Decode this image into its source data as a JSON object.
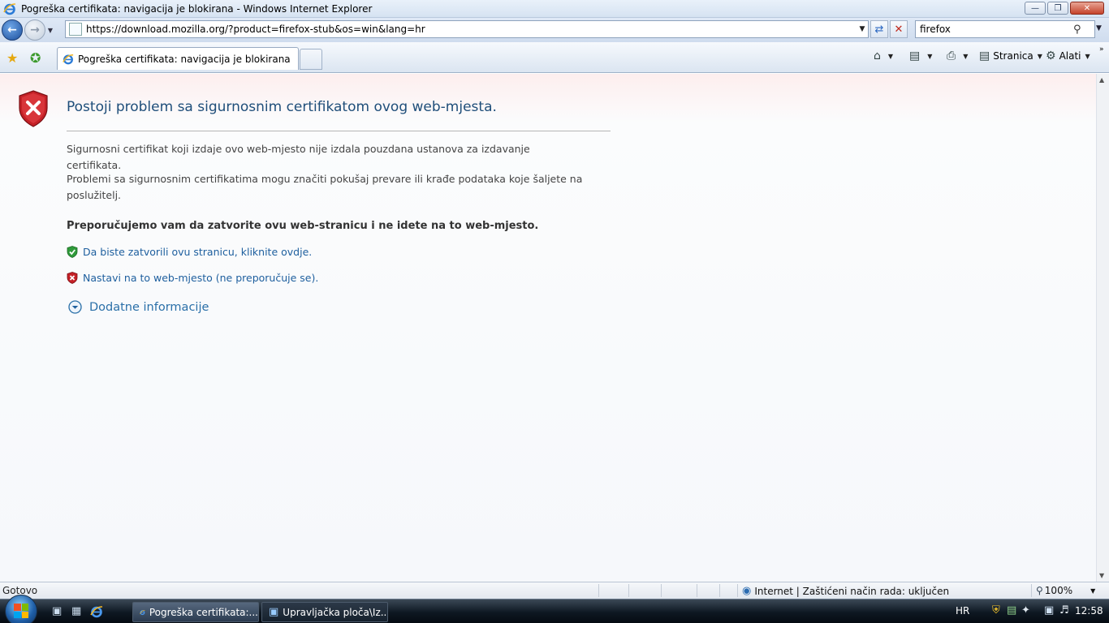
{
  "window": {
    "title": "Pogreška certifikata: navigacija je blokirana - Windows Internet Explorer",
    "buttons": {
      "minimize_icon": "minimize-icon",
      "restore_icon": "restore-icon",
      "close_icon": "close-icon"
    }
  },
  "addressbar": {
    "url": "https://download.mozilla.org/?product=firefox-stub&os=win&lang=hr",
    "search_value": "firefox"
  },
  "tabs": [
    {
      "label": "Pogreška certifikata: navigacija je blokirana"
    }
  ],
  "commandbar": {
    "page_label": "Stranica",
    "tools_label": "Alati"
  },
  "page": {
    "heading": "Postoji problem sa sigurnosnim certifikatom ovog web-mjesta.",
    "para1": "Sigurnosni certifikat koji izdaje ovo web-mjesto nije izdala pouzdana ustanova za izdavanje certifikata.",
    "para2": "Problemi sa sigurnosnim certifikatima mogu značiti pokušaj prevare ili krađe podataka koje šaljete na poslužitelj.",
    "recommendation": "Preporučujemo vam da zatvorite ovu web-stranicu i ne idete na to web-mjesto.",
    "link_close": "Da biste zatvorili ovu stranicu, kliknite ovdje.",
    "link_continue": "Nastavi na to web-mjesto (ne preporučuje se).",
    "more_info": "Dodatne informacije"
  },
  "statusbar": {
    "status": "Gotovo",
    "zone": "Internet | Zaštićeni način rada: uključen",
    "zoom": "100%"
  },
  "taskbar": {
    "tasks": [
      {
        "label": "Pogreška certifikata:..."
      },
      {
        "label": "Upravljačka ploča\\Iz..."
      }
    ],
    "language": "HR",
    "clock": "12:58"
  },
  "colors": {
    "heading": "#1f4e7a",
    "link": "#1e5f9e",
    "shield_red": "#c42127",
    "shield_green": "#2f9a3a"
  }
}
